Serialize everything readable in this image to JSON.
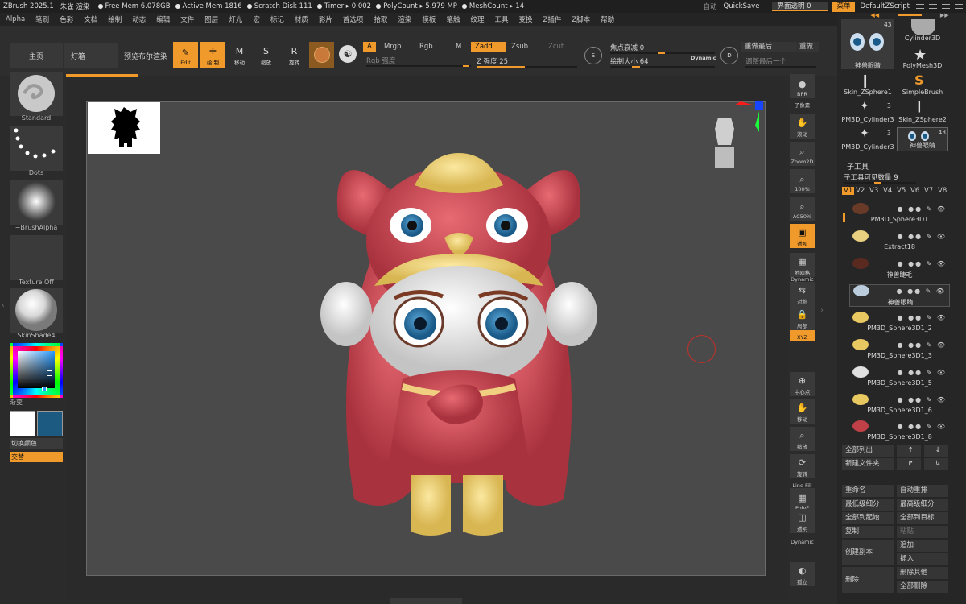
{
  "titlebar": {
    "app": "ZBrush 2025.1",
    "doc": "朱雀 渲染",
    "stats": [
      "Free Mem 6.078GB",
      "Active Mem 1816",
      "Scratch Disk 111",
      "Timer ▸ 0.002",
      "PolyCount ▸ 5.979 MP",
      "MeshCount ▸ 14"
    ],
    "auto_label": "自动",
    "quicksave": "QuickSave",
    "transparency": "界面透明 0",
    "menu": "菜单",
    "script": "DefaultZScript"
  },
  "menubar": [
    "Alpha",
    "笔刷",
    "色彩",
    "文档",
    "绘制",
    "动态",
    "编辑",
    "文件",
    "图层",
    "灯光",
    "宏",
    "标记",
    "材质",
    "影片",
    "首选项",
    "拾取",
    "渲染",
    "模板",
    "笔触",
    "纹理",
    "工具",
    "变换",
    "Z插件",
    "Z脚本",
    "帮助"
  ],
  "shelf": {
    "home": "主页",
    "lightbox": "灯箱",
    "preview_bool": "预览布尔渲染",
    "tools": [
      {
        "label": "Edit",
        "glyph": "✎",
        "active": true
      },
      {
        "label": "绘 制",
        "glyph": "✛",
        "active": true
      },
      {
        "label": "移动",
        "glyph": "M",
        "active": false
      },
      {
        "label": "缩放",
        "glyph": "S",
        "active": false
      },
      {
        "label": "旋转",
        "glyph": "R",
        "active": false
      }
    ],
    "a_label": "A",
    "mrgb": "Mrgb",
    "rgb": "Rgb",
    "m": "M",
    "zadd": "Zadd",
    "zsub": "Zsub",
    "zcut": "Zcut",
    "rgb_intensity": "Rgb 强度",
    "z_intensity": "Z 强度 25",
    "focal_shift": "焦点衰减 0",
    "draw_size": "绘制大小 64",
    "dynamic": "Dynamic",
    "redo_last": "重做最后",
    "redo": "重做",
    "undo_last": "调整最后一个"
  },
  "left": {
    "brush": "Standard",
    "stroke": "Dots",
    "alpha": "~BrushAlpha",
    "texture": "Texture Off",
    "material": "SkinShade4",
    "gradient": "渐变",
    "switch_color": "切换颜色",
    "alternate": "交替",
    "colors": {
      "main": "#ffffff",
      "secondary": "#1d5a82"
    }
  },
  "right_tools": [
    {
      "label": "BPR",
      "glyph": "●",
      "active": false
    },
    {
      "label": "子像素",
      "glyph": "",
      "active": false
    },
    {
      "label": "滚动",
      "glyph": "✋",
      "active": false
    },
    {
      "label": "Zoom2D",
      "glyph": "⌕",
      "active": false
    },
    {
      "label": "100%",
      "glyph": "⌕",
      "active": false
    },
    {
      "label": "AC50%",
      "glyph": "⌕",
      "active": false
    },
    {
      "label": "透视",
      "glyph": "▣",
      "active": true
    },
    {
      "label": "地网格",
      "glyph": "▦",
      "active": false
    },
    {
      "label": "Dynamic",
      "glyph": "",
      "active": false
    },
    {
      "label": "对称",
      "glyph": "⇆",
      "active": false
    },
    {
      "label": "局部",
      "glyph": "🔒",
      "active": false
    },
    {
      "label": "XYZ",
      "glyph": "",
      "active": true
    },
    {
      "label": "中心点",
      "glyph": "⊕",
      "active": false
    },
    {
      "label": "移动",
      "glyph": "✋",
      "active": false
    },
    {
      "label": "缩放",
      "glyph": "⌕",
      "active": false
    },
    {
      "label": "旋转",
      "glyph": "⟳",
      "active": false
    },
    {
      "label": "Line Fill",
      "glyph": "",
      "active": false
    },
    {
      "label": "PolyF",
      "glyph": "▦",
      "active": false
    },
    {
      "label": "透明",
      "glyph": "◫",
      "active": false
    },
    {
      "label": "Dynamic",
      "glyph": "",
      "active": true
    },
    {
      "label": "孤立",
      "glyph": "◐",
      "active": false
    }
  ],
  "right_panel": {
    "thumbs": [
      {
        "name": "神兽眼睛",
        "count": "43"
      },
      {
        "name": "Cylinder3D",
        "count": ""
      },
      {
        "name": "PolyMesh3D",
        "count": ""
      },
      {
        "name": "Skin_ZSphere1",
        "count": ""
      },
      {
        "name": "SimpleBrush",
        "count": ""
      },
      {
        "name": "PM3D_Cylinder3",
        "count": "3"
      },
      {
        "name": "Skin_ZSphere2",
        "count": ""
      },
      {
        "name": "PM3D_Cylinder3",
        "count": "3"
      },
      {
        "name": "神兽眼睛",
        "count": "43"
      }
    ],
    "subtool_header": "子工具",
    "visible_count": "子工具可见数量 9",
    "versions": [
      "V1",
      "V2",
      "V3",
      "V4",
      "V5",
      "V6",
      "V7",
      "V8"
    ],
    "subtools": [
      "PM3D_Sphere3D1",
      "Extract18",
      "神兽睫毛",
      "神兽眼睛",
      "PM3D_Sphere3D1_2",
      "PM3D_Sphere3D1_3",
      "PM3D_Sphere3D1_5",
      "PM3D_Sphere3D1_6",
      "PM3D_Sphere3D1_8"
    ],
    "buttons": {
      "list_all": "全部列出",
      "new_folder": "新建文件夹",
      "rename": "重命名",
      "auto_reorder": "自动重排",
      "lowest_res": "最低级细分",
      "highest_res": "最高级细分",
      "all_to_start": "全部到起始",
      "all_to_target": "全部到目标",
      "copy": "复制",
      "paste": "粘贴",
      "duplicate": "创建副本",
      "append": "追加",
      "insert": "插入",
      "delete": "删除",
      "delete_other": "删除其他",
      "delete_all": "全部删除"
    }
  }
}
